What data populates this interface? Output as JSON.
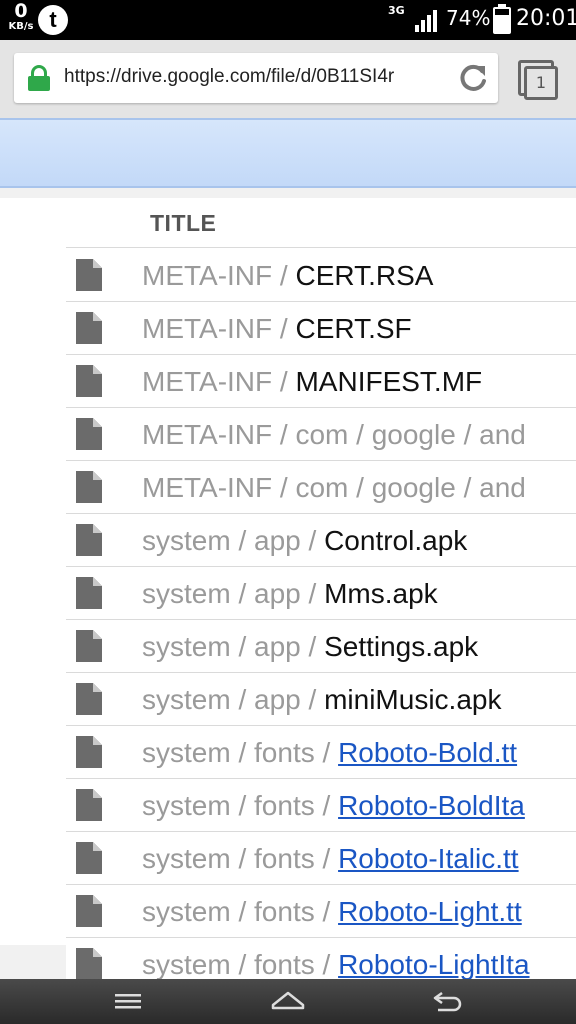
{
  "status_bar": {
    "net_speed_value": "0",
    "net_speed_unit": "KB/s",
    "app_icon_letter": "t",
    "network_type": "3G",
    "battery_percent": "74%",
    "time": "20:01"
  },
  "browser": {
    "url": "https://drive.google.com/file/d/0B11SI4r",
    "tab_count": "1"
  },
  "file_list": {
    "column_title": "TITLE",
    "rows": [
      {
        "path": "META-INF / ",
        "name": "CERT.RSA",
        "link": false
      },
      {
        "path": "META-INF / ",
        "name": "CERT.SF",
        "link": false
      },
      {
        "path": "META-INF / ",
        "name": "MANIFEST.MF",
        "link": false
      },
      {
        "path": "META-INF / com / google / and",
        "name": "",
        "link": false
      },
      {
        "path": "META-INF / com / google / and",
        "name": "",
        "link": false
      },
      {
        "path": "system / app / ",
        "name": "Control.apk",
        "link": false
      },
      {
        "path": "system / app / ",
        "name": "Mms.apk",
        "link": false
      },
      {
        "path": "system / app / ",
        "name": "Settings.apk",
        "link": false
      },
      {
        "path": "system / app / ",
        "name": "miniMusic.apk",
        "link": false
      },
      {
        "path": "system / fonts / ",
        "name": "Roboto-Bold.tt",
        "link": true
      },
      {
        "path": "system / fonts / ",
        "name": "Roboto-BoldIta",
        "link": true
      },
      {
        "path": "system / fonts / ",
        "name": "Roboto-Italic.tt",
        "link": true
      },
      {
        "path": "system / fonts / ",
        "name": "Roboto-Light.tt",
        "link": true
      },
      {
        "path": "system / fonts / ",
        "name": "Roboto-LightIta",
        "link": true
      }
    ]
  },
  "colors": {
    "header_band": "#c3d9f8",
    "link": "#1a56c4",
    "path_gray": "#9a9a9a",
    "lock_green": "#2fa84a"
  },
  "icons": {
    "file": "file-icon",
    "lock": "lock-icon",
    "reload": "reload-icon",
    "tabs": "tabs-icon",
    "menu": "menu-icon",
    "home": "home-icon",
    "back": "back-icon"
  }
}
